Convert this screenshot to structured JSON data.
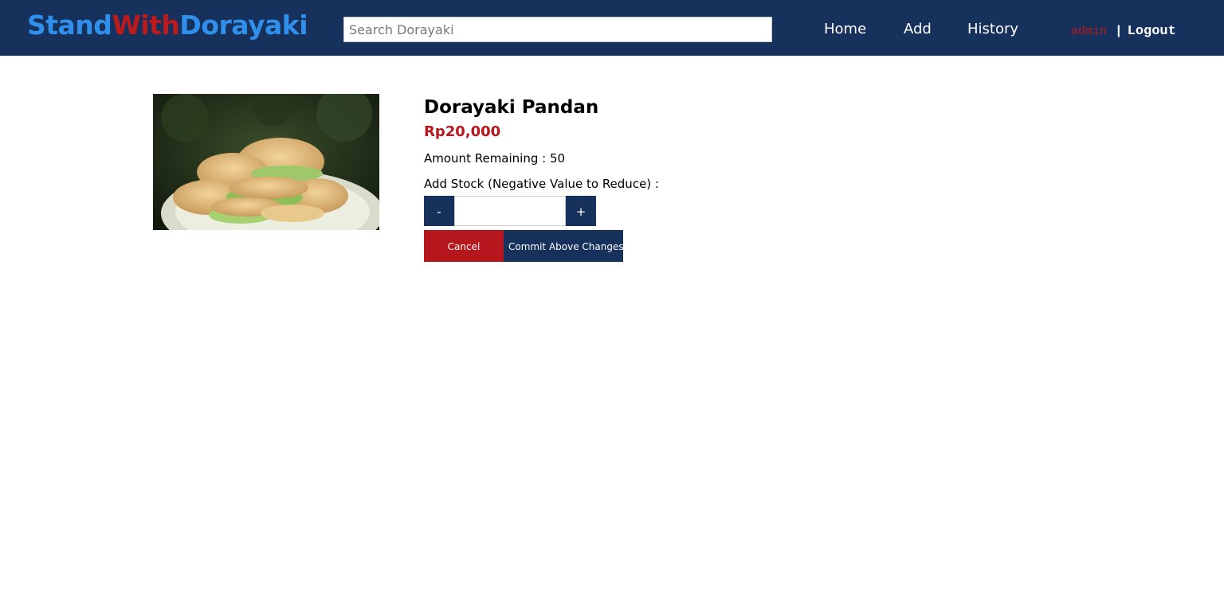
{
  "header": {
    "brand": {
      "part1": "Stand",
      "part2": "With",
      "part3": "Dorayaki"
    },
    "search": {
      "placeholder": "Search Dorayaki",
      "value": ""
    },
    "nav": {
      "home": "Home",
      "add": "Add",
      "history": "History"
    },
    "user": {
      "username": "admin",
      "separator": "|",
      "logout": "Logout"
    }
  },
  "product": {
    "image_icon": "dorayaki-photo",
    "name": "Dorayaki Pandan",
    "price": "Rp20,000",
    "amount_label": "Amount Remaining :",
    "amount_value": "50",
    "add_stock_label": "Add Stock (Negative Value to Reduce) :",
    "stepper": {
      "minus_label": "-",
      "plus_label": "+",
      "value": ""
    },
    "actions": {
      "cancel": "Cancel",
      "commit": "Commit Above Changes"
    }
  },
  "colors": {
    "navbar": "#16315c",
    "brand_blue": "#2f8fea",
    "brand_red": "#bd1a1e",
    "price_red": "#b5171d"
  }
}
